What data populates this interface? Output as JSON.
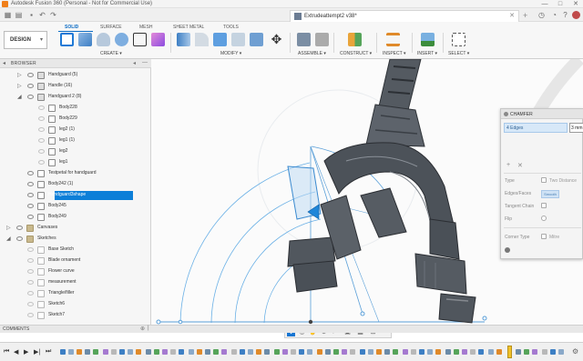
{
  "window": {
    "title": "Autodesk Fusion 360 (Personal - Not for Commercial Use)",
    "minimize": "—",
    "maximize": "□",
    "close": "✕"
  },
  "document": {
    "tab_title": "Extrudeattempt2 v38*",
    "close_glyph": "✕",
    "new_tab_glyph": "+"
  },
  "ribbon": {
    "workspace_label": "DESIGN",
    "workspace_chevron": "▾",
    "tabs": [
      "SOLID",
      "SURFACE",
      "MESH",
      "SHEET METAL",
      "TOOLS"
    ],
    "active_tab": "SOLID",
    "groups": [
      "CREATE ▾",
      "MODIFY ▾",
      "ASSEMBLE ▾",
      "CONSTRUCT ▾",
      "INSPECT ▾",
      "INSERT ▾",
      "SELECT ▾"
    ]
  },
  "browser": {
    "title": "BROWSER",
    "rows": [
      {
        "label": "Handguard (5)",
        "icon": "component-icon"
      },
      {
        "label": "Handle (16)",
        "icon": "component-icon"
      },
      {
        "label": "Handguard 2 (8)",
        "icon": "component-icon"
      },
      {
        "label": "Body228",
        "icon": "body-icon"
      },
      {
        "label": "Body229",
        "icon": "body-icon"
      },
      {
        "label": "leg2 (1)",
        "icon": "body-icon"
      },
      {
        "label": "leg1 (1)",
        "icon": "body-icon"
      },
      {
        "label": "leg2",
        "icon": "body-icon"
      },
      {
        "label": "leg1",
        "icon": "body-icon"
      },
      {
        "label": "Testpetal for handguard",
        "icon": "body-icon"
      },
      {
        "label": "Body242 (1)",
        "icon": "body-icon"
      },
      {
        "label": "Handguard3shape",
        "icon": "body-icon"
      },
      {
        "label": "Body245",
        "icon": "body-icon"
      },
      {
        "label": "Body249",
        "icon": "body-icon"
      },
      {
        "label": "Canvases",
        "icon": "folder-icon"
      },
      {
        "label": "Sketches",
        "icon": "folder-icon"
      },
      {
        "label": "Base Sketch",
        "icon": "sketch-icon"
      },
      {
        "label": "Blade ornament",
        "icon": "sketch-icon"
      },
      {
        "label": "Flower curve",
        "icon": "sketch-icon"
      },
      {
        "label": "measurement",
        "icon": "sketch-icon"
      },
      {
        "label": "Triangle/filler",
        "icon": "sketch-icon"
      },
      {
        "label": "Sketch6",
        "icon": "sketch-icon"
      },
      {
        "label": "Sketch7",
        "icon": "sketch-icon"
      }
    ],
    "selected": "Handguard3shape"
  },
  "comments": {
    "title": "COMMENTS"
  },
  "chamfer": {
    "title": "CHAMFER",
    "edges_label": "4 Edges",
    "distance_value": "3 mm",
    "rows": [
      {
        "label": "Type",
        "value": "Two Distance"
      },
      {
        "label": "Edges/Faces",
        "value": "Smooth"
      },
      {
        "label": "Tangent Chain",
        "value": ""
      },
      {
        "label": "Flip",
        "value": ""
      },
      {
        "label": "Corner Type",
        "value": "Mitre"
      }
    ]
  },
  "colors": {
    "accent": "#0a6bc4",
    "selection": "#0d7fd8",
    "body_dark": "#4a4f55",
    "sketch_line": "#5aa6e0"
  }
}
